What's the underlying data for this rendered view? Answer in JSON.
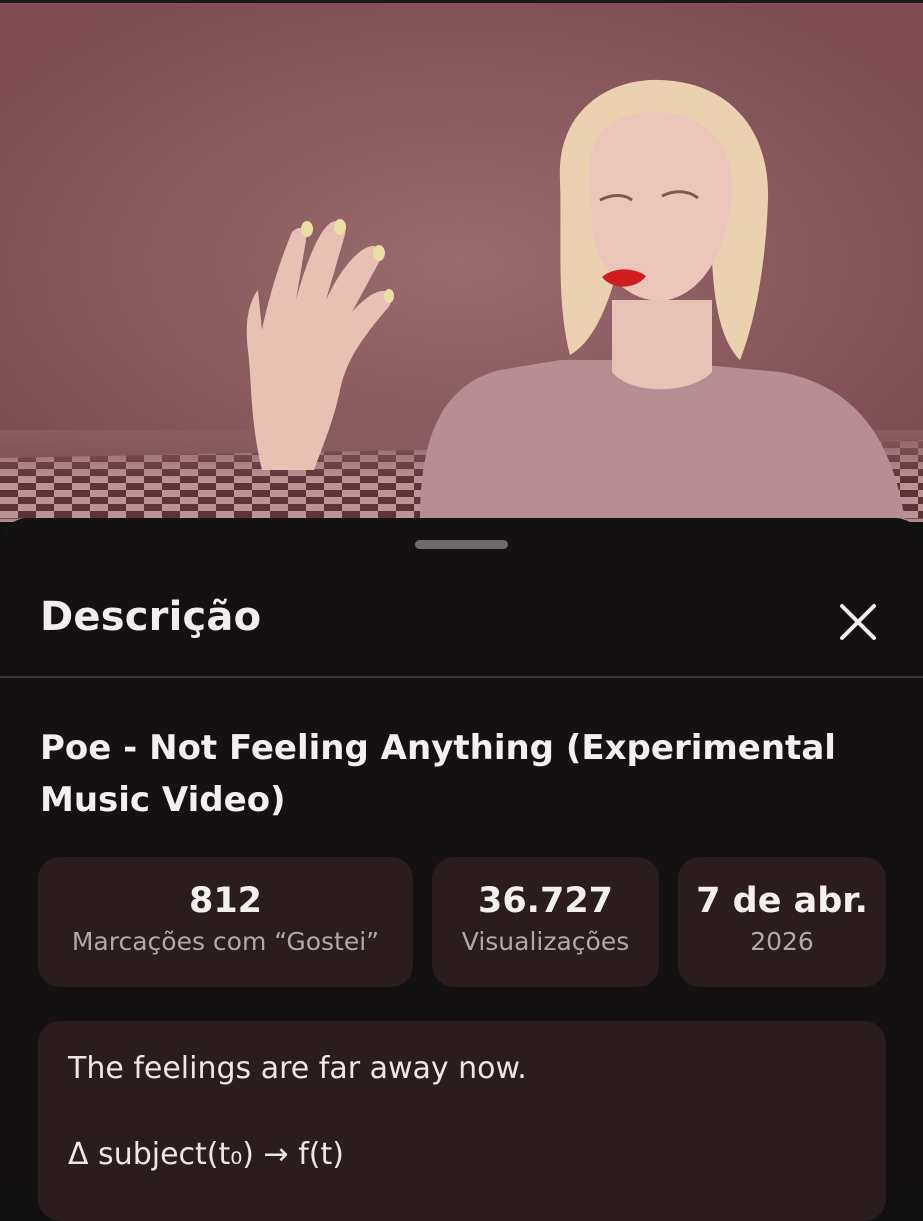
{
  "sheet": {
    "title": "Descrição",
    "close_icon": "close-icon"
  },
  "video": {
    "title": "Poe - Not Feeling Anything (Experimental Music Video)"
  },
  "stats": {
    "likes": {
      "value": "812",
      "label": "Marcações com “Gostei”"
    },
    "views": {
      "value": "36.727",
      "label": "Visualizações"
    },
    "date": {
      "value": "7 de abr.",
      "label": "2026"
    }
  },
  "description": {
    "line1": "The feelings are far away now.",
    "line2": "Δ subject(t₀) → f(t)"
  },
  "colors": {
    "background": "#131111",
    "card": "#2b1c1e",
    "video_tint": "#8a5b60"
  }
}
